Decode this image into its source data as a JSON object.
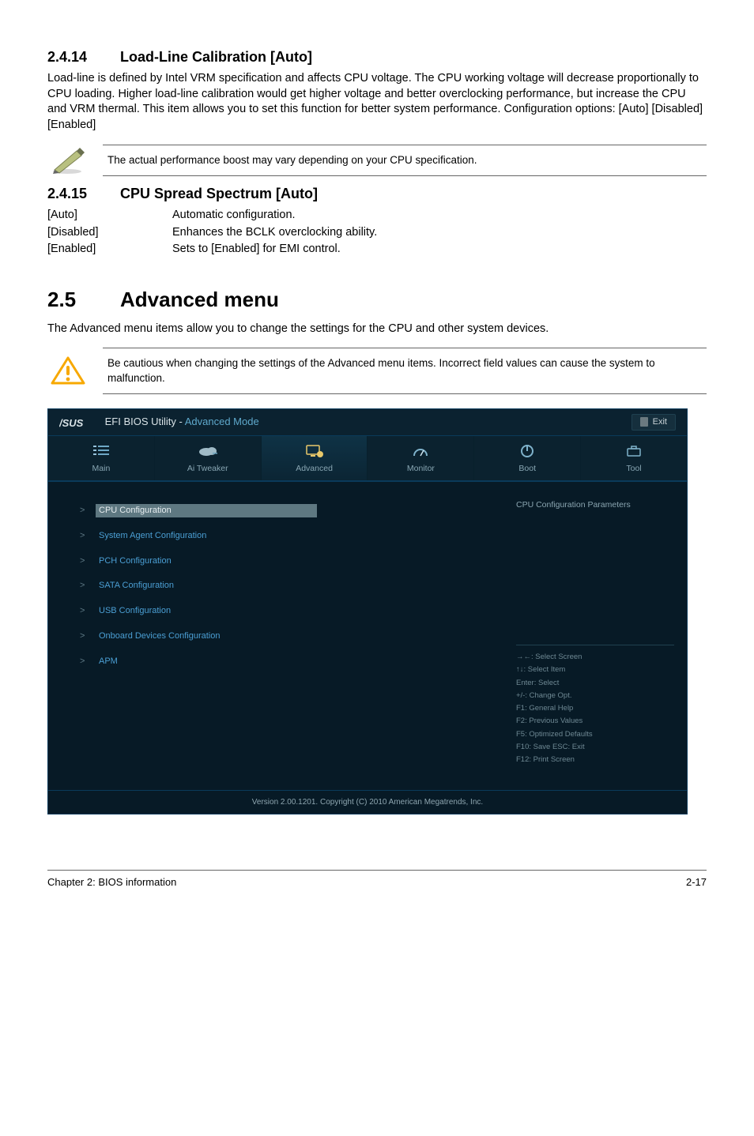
{
  "s1": {
    "num": "2.4.14",
    "title": "Load-Line Calibration [Auto]",
    "body": "Load-line is defined by Intel VRM specification and affects CPU voltage. The CPU working voltage will decrease proportionally to CPU loading. Higher load-line calibration would get higher voltage and better overclocking performance, but increase the CPU and VRM thermal. This item allows you to set this function for better system performance. Configuration options: [Auto] [Disabled] [Enabled]"
  },
  "note1": "The actual performance boost may vary depending on your CPU specification.",
  "s2": {
    "num": "2.4.15",
    "title": "CPU Spread Spectrum [Auto]",
    "opts": [
      {
        "k": "[Auto]",
        "v": "Automatic configuration."
      },
      {
        "k": "[Disabled]",
        "v": "Enhances the BCLK overclocking ability."
      },
      {
        "k": "[Enabled]",
        "v": "Sets to [Enabled] for EMI control."
      }
    ]
  },
  "s3": {
    "num": "2.5",
    "title": "Advanced menu",
    "body": "The Advanced menu items allow you to change the settings for the CPU and other system devices."
  },
  "note2": "Be cautious when changing the settings of the Advanced menu items. Incorrect field values can cause the system to malfunction.",
  "bios": {
    "brand_white": "EFI BIOS Utility - ",
    "brand_blue": "Advanced Mode",
    "exit": "Exit",
    "tabs": [
      "Main",
      "Ai Tweaker",
      "Advanced",
      "Monitor",
      "Boot",
      "Tool"
    ],
    "menu": [
      "CPU Configuration",
      "System Agent Configuration",
      "PCH Configuration",
      "SATA Configuration",
      "USB Configuration",
      "Onboard Devices Configuration",
      "APM"
    ],
    "help_title": "CPU Configuration Parameters",
    "help_keys": [
      "→←: Select Screen",
      "↑↓: Select Item",
      "Enter: Select",
      "+/-: Change Opt.",
      "F1: General Help",
      "F2: Previous Values",
      "F5: Optimized Defaults",
      "F10: Save   ESC: Exit",
      "F12: Print Screen"
    ],
    "footer": "Version 2.00.1201.  Copyright (C) 2010 American Megatrends, Inc."
  },
  "footer": {
    "left": "Chapter 2: BIOS information",
    "right": "2-17"
  }
}
